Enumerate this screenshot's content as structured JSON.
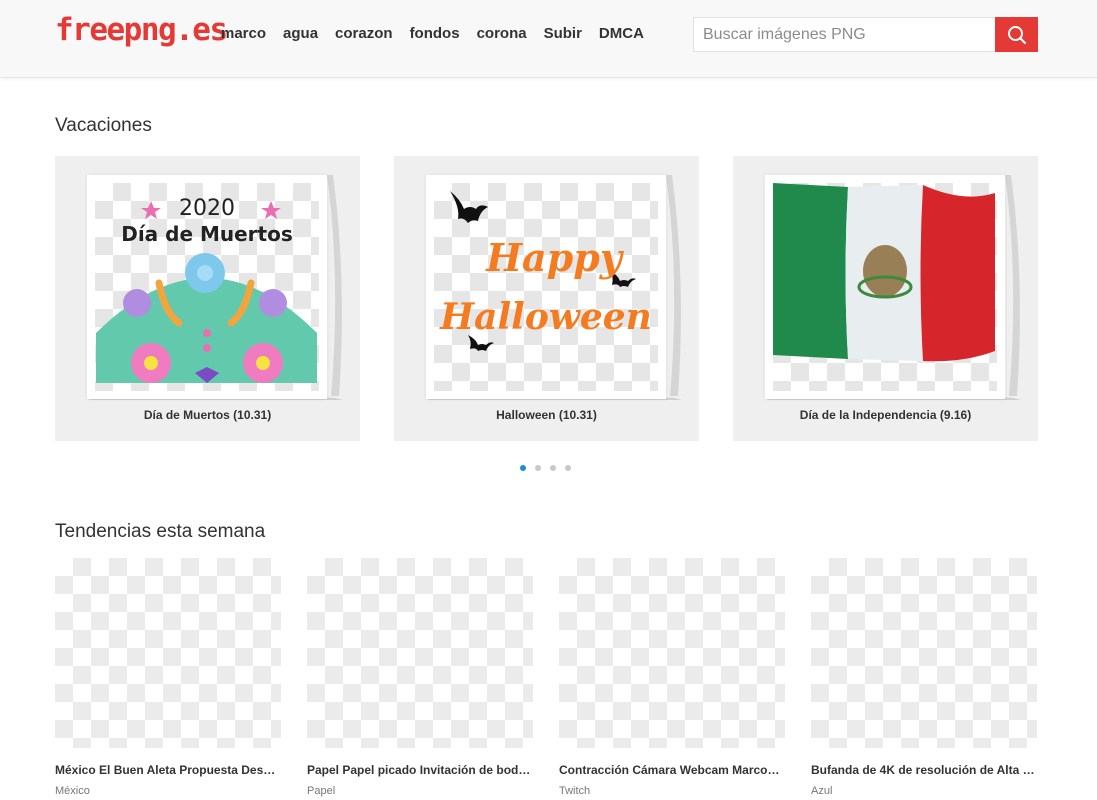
{
  "brand": {
    "logo_text": "freepng.es",
    "accent_color": "#e53935"
  },
  "nav": [
    {
      "label": "marco"
    },
    {
      "label": "agua"
    },
    {
      "label": "corazon"
    },
    {
      "label": "fondos"
    },
    {
      "label": "corona"
    },
    {
      "label": "Subir"
    },
    {
      "label": "DMCA"
    }
  ],
  "search": {
    "placeholder": "Buscar imágenes PNG",
    "value": ""
  },
  "holidays": {
    "title": "Vacaciones",
    "items": [
      {
        "caption": "Día de Muertos (10.31)",
        "image_text_1": "2020",
        "image_text_2": "Día de Muertos"
      },
      {
        "caption": "Halloween (10.31)",
        "image_text_1": "Happy",
        "image_text_2": "Halloween"
      },
      {
        "caption": "Día de la Independencia (9.16)"
      }
    ],
    "pagination_total": 4,
    "pagination_active": 1
  },
  "trending": {
    "title": "Tendencias esta semana",
    "items": [
      {
        "title": "México El Buen Aleta Propuesta Des…",
        "tag": "México"
      },
      {
        "title": "Papel Papel picado Invitación de bod…",
        "tag": "Papel"
      },
      {
        "title": "Contracción Cámara Webcam Marco…",
        "tag": "Twitch"
      },
      {
        "title": "Bufanda de 4K de resolución de Alta …",
        "tag": "Azul"
      }
    ]
  }
}
